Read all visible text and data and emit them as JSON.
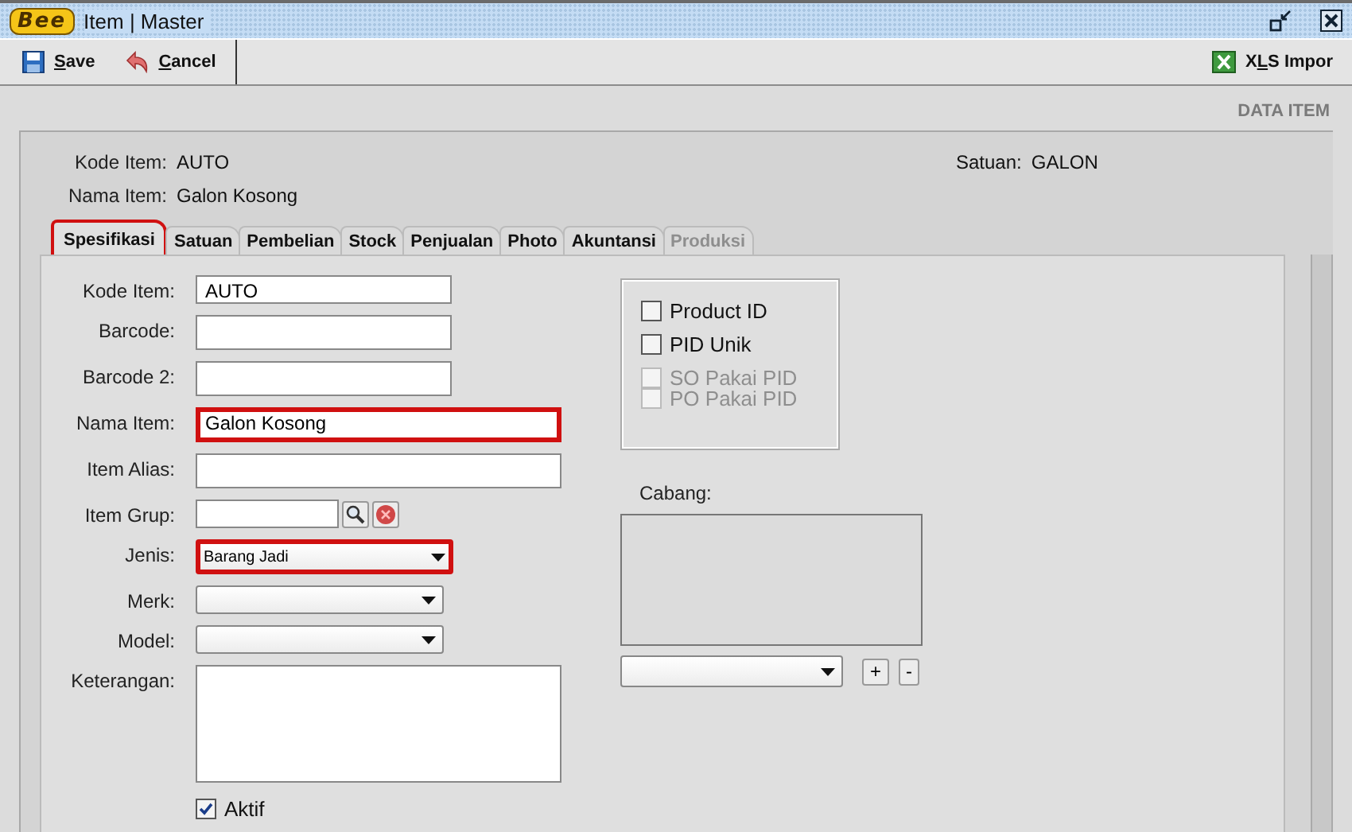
{
  "window": {
    "title": "Item | Master",
    "logo": "Bee"
  },
  "toolbar": {
    "left": [
      {
        "label": "Save"
      },
      {
        "label": "Cancel"
      }
    ],
    "right": [
      {
        "label": "XLS Impor"
      }
    ]
  },
  "section_title": "DATA ITEM",
  "header": [
    {
      "label": "Kode Item:",
      "value": "AUTO"
    },
    {
      "label": "Nama Item:",
      "value": "Galon Kosong"
    }
  ],
  "header_right": {
    "label": "Satuan:",
    "value": "GALON"
  },
  "tabs": [
    {
      "label": "Spesifikasi",
      "selected": true,
      "disabled": false,
      "highlighted": true
    },
    {
      "label": "Satuan",
      "selected": false,
      "disabled": false,
      "highlighted": false
    },
    {
      "label": "Pembelian",
      "selected": false,
      "disabled": false,
      "highlighted": false
    },
    {
      "label": "Stock",
      "selected": false,
      "disabled": false,
      "highlighted": false
    },
    {
      "label": "Penjualan",
      "selected": false,
      "disabled": false,
      "highlighted": false
    },
    {
      "label": "Photo",
      "selected": false,
      "disabled": false,
      "highlighted": false
    },
    {
      "label": "Akuntansi",
      "selected": false,
      "disabled": false,
      "highlighted": false
    },
    {
      "label": "Produksi",
      "selected": false,
      "disabled": true,
      "highlighted": false
    }
  ],
  "fields": [
    {
      "kind": "text",
      "label": "Kode Item:",
      "value": "AUTO",
      "highlighted": false
    },
    {
      "kind": "text",
      "label": "Barcode:",
      "highlighted": false
    },
    {
      "kind": "text",
      "label": "Barcode 2:",
      "highlighted": false
    },
    {
      "kind": "longtext",
      "label": "Nama Item:",
      "value": "Galon Kosong",
      "highlighted": true
    },
    {
      "kind": "longtext",
      "label": "Item Alias:",
      "highlighted": false
    },
    {
      "kind": "lookup",
      "label": "Item Grup:",
      "highlighted": false
    },
    {
      "kind": "combo",
      "label": "Jenis:",
      "value": "Barang Jadi",
      "highlighted": true
    },
    {
      "kind": "combo",
      "label": "Merk:",
      "highlighted": false
    },
    {
      "kind": "combo",
      "label": "Model:",
      "highlighted": false
    },
    {
      "kind": "textarea",
      "label": "Keterangan:",
      "highlighted": false
    }
  ],
  "aktif": {
    "label": "Aktif",
    "checked": true
  },
  "options": [
    {
      "label": "Product ID",
      "checked": false,
      "disabled": false
    },
    {
      "label": "PID Unik",
      "checked": false,
      "disabled": false
    },
    {
      "label": "SO Pakai PID",
      "checked": false,
      "disabled": true
    },
    {
      "label": "PO Pakai PID",
      "checked": false,
      "disabled": true
    }
  ],
  "cabang": {
    "label": "Cabang:",
    "add": "+",
    "remove": "-"
  }
}
